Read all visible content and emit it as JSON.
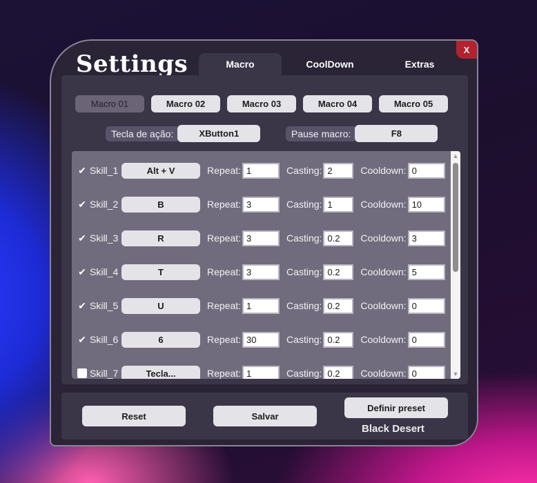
{
  "window": {
    "title": "Settings",
    "close_label": "X",
    "tabs": [
      {
        "label": "Macro",
        "active": true
      },
      {
        "label": "CoolDown",
        "active": false
      },
      {
        "label": "Extras",
        "active": false
      }
    ]
  },
  "macros": [
    {
      "label": "Macro 01",
      "active": true
    },
    {
      "label": "Macro 02",
      "active": false
    },
    {
      "label": "Macro 03",
      "active": false
    },
    {
      "label": "Macro 04",
      "active": false
    },
    {
      "label": "Macro 05",
      "active": false
    }
  ],
  "action": {
    "key_label": "Tecla de ação:",
    "key_value": "XButton1",
    "pause_label": "Pause macro:",
    "pause_value": "F8"
  },
  "skill_labels": {
    "repeat": "Repeat:",
    "casting": "Casting:",
    "cooldown": "Cooldown:"
  },
  "skills": [
    {
      "name": "Skill_1",
      "checked": true,
      "key": "Alt + V",
      "repeat": "1",
      "casting": "2",
      "cooldown": "0"
    },
    {
      "name": "Skill_2",
      "checked": true,
      "key": "B",
      "repeat": "3",
      "casting": "1",
      "cooldown": "10"
    },
    {
      "name": "Skill_3",
      "checked": true,
      "key": "R",
      "repeat": "3",
      "casting": "0.2",
      "cooldown": "3"
    },
    {
      "name": "Skill_4",
      "checked": true,
      "key": "T",
      "repeat": "3",
      "casting": "0.2",
      "cooldown": "5"
    },
    {
      "name": "Skill_5",
      "checked": true,
      "key": "U",
      "repeat": "1",
      "casting": "0.2",
      "cooldown": "0"
    },
    {
      "name": "Skill_6",
      "checked": true,
      "key": "6",
      "repeat": "30",
      "casting": "0.2",
      "cooldown": "0"
    },
    {
      "name": "Skill_7",
      "checked": false,
      "key": "Tecla...",
      "repeat": "1",
      "casting": "0.2",
      "cooldown": "0"
    }
  ],
  "bottom": {
    "reset_label": "Reset",
    "save_label": "Salvar",
    "preset_label": "Definir preset",
    "preset_name": "Black Desert"
  },
  "icons": {
    "checked": "✔",
    "scroll_up": "▲",
    "scroll_down": "▼"
  }
}
